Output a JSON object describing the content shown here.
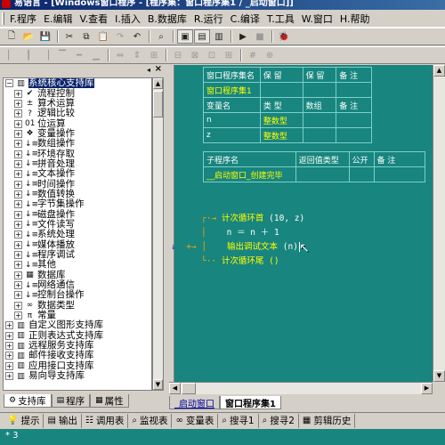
{
  "window": {
    "title": "易语言 - [Windows窗口程序 - [程序集：窗口程序集1 / _启动窗口]]"
  },
  "menu": {
    "items": [
      {
        "label": "F.程序"
      },
      {
        "label": "E.编辑"
      },
      {
        "label": "V.查看"
      },
      {
        "label": "I.插入"
      },
      {
        "label": "B.数据库"
      },
      {
        "label": "R.运行"
      },
      {
        "label": "C.编译"
      },
      {
        "label": "T.工具"
      },
      {
        "label": "W.窗口"
      },
      {
        "label": "H.帮助"
      }
    ]
  },
  "toolbar1": {
    "icons": [
      "new-file-icon",
      "open-folder-icon",
      "save-icon",
      "cut-icon",
      "copy-icon",
      "paste-icon",
      "redo-icon",
      "undo-icon",
      "find-icon",
      "layout-1-icon",
      "layout-2-icon",
      "layout-3-icon",
      "run-icon",
      "stop-icon",
      "debug-icon"
    ]
  },
  "left_panel": {
    "tree": [
      {
        "label": "系统核心支持库",
        "level": 0,
        "expander": "−",
        "icon": "library-icon",
        "selected": true
      },
      {
        "label": "流程控制",
        "level": 1,
        "expander": "+",
        "icon": "flow-control-icon"
      },
      {
        "label": "算术运算",
        "level": 1,
        "expander": "+",
        "icon": "arithmetic-icon"
      },
      {
        "label": "逻辑比较",
        "level": 1,
        "expander": "+",
        "icon": "logic-icon"
      },
      {
        "label": "位运算",
        "level": 1,
        "expander": "+",
        "icon": "bitwise-icon"
      },
      {
        "label": "变量操作",
        "level": 1,
        "expander": "+",
        "icon": "variable-icon"
      },
      {
        "label": "数组操作",
        "level": 1,
        "expander": "+",
        "icon": "array-icon"
      },
      {
        "label": "环境存取",
        "level": 1,
        "expander": "+",
        "icon": "environment-icon"
      },
      {
        "label": "拼音处理",
        "level": 1,
        "expander": "+",
        "icon": "pinyin-icon"
      },
      {
        "label": "文本操作",
        "level": 1,
        "expander": "+",
        "icon": "text-icon"
      },
      {
        "label": "时间操作",
        "level": 1,
        "expander": "+",
        "icon": "time-icon"
      },
      {
        "label": "数值转换",
        "level": 1,
        "expander": "+",
        "icon": "number-convert-icon"
      },
      {
        "label": "字节集操作",
        "level": 1,
        "expander": "+",
        "icon": "byteset-icon"
      },
      {
        "label": "磁盘操作",
        "level": 1,
        "expander": "+",
        "icon": "disk-icon"
      },
      {
        "label": "文件读写",
        "level": 1,
        "expander": "+",
        "icon": "file-rw-icon"
      },
      {
        "label": "系统处理",
        "level": 1,
        "expander": "+",
        "icon": "system-icon"
      },
      {
        "label": "媒体播放",
        "level": 1,
        "expander": "+",
        "icon": "media-icon"
      },
      {
        "label": "程序调试",
        "level": 1,
        "expander": "+",
        "icon": "debug-tree-icon"
      },
      {
        "label": "其他",
        "level": 1,
        "expander": "+",
        "icon": "other-icon"
      },
      {
        "label": "数据库",
        "level": 1,
        "expander": "+",
        "icon": "database-icon"
      },
      {
        "label": "网络通信",
        "level": 1,
        "expander": "+",
        "icon": "network-icon"
      },
      {
        "label": "控制台操作",
        "level": 1,
        "expander": "+",
        "icon": "console-icon"
      },
      {
        "label": "数据类型",
        "level": 1,
        "expander": "+",
        "icon": "datatype-icon"
      },
      {
        "label": "常量",
        "level": 1,
        "expander": "+",
        "icon": "constant-icon"
      },
      {
        "label": "自定义图形支持库",
        "level": 0,
        "expander": "+",
        "icon": "library-icon"
      },
      {
        "label": "正则表达式支持库",
        "level": 0,
        "expander": "+",
        "icon": "library-icon"
      },
      {
        "label": "远程服务支持库",
        "level": 0,
        "expander": "+",
        "icon": "library-icon"
      },
      {
        "label": "邮件接收支持库",
        "level": 0,
        "expander": "+",
        "icon": "library-icon"
      },
      {
        "label": "应用接口支持库",
        "level": 0,
        "expander": "+",
        "icon": "library-icon"
      },
      {
        "label": "易向导支持库",
        "level": 0,
        "expander": "+",
        "icon": "library-icon"
      }
    ],
    "tabs": [
      {
        "label": "支持库",
        "icon": "support-lib-tab-icon",
        "active": true
      },
      {
        "label": "程序",
        "icon": "program-tab-icon",
        "active": false
      },
      {
        "label": "属性",
        "icon": "property-tab-icon",
        "active": false
      }
    ]
  },
  "editor": {
    "class_table": {
      "headers": [
        "窗口程序集名",
        "保 留",
        "保 留",
        "备 注"
      ],
      "row": [
        "窗口程序集1",
        "",
        "",
        ""
      ]
    },
    "var_table": {
      "headers": [
        "变量名",
        "类 型",
        "数组",
        "备 注"
      ],
      "rows": [
        [
          "n",
          "整数型",
          "",
          ""
        ],
        [
          "z",
          "整数型",
          "",
          ""
        ]
      ]
    },
    "sub_table": {
      "headers": [
        "子程序名",
        "返回值类型",
        "公开",
        "备 注"
      ],
      "row": [
        "__启动窗口_创建完毕",
        "",
        "",
        ""
      ]
    },
    "code": {
      "line1_prefix": "计次循环首",
      "line1_args": "(10, z)",
      "line2": "n ＝ n ＋ 1",
      "line3_func": "输出调试文本",
      "line3_args": "(n)",
      "line4": "计次循环尾 ()"
    },
    "tabs": [
      {
        "label": "_启动窗口",
        "active": false
      },
      {
        "label": "窗口程序集1",
        "active": true
      }
    ]
  },
  "bottom_tabs": [
    {
      "label": "提示",
      "icon": "hint-icon"
    },
    {
      "label": "输出",
      "icon": "output-icon"
    },
    {
      "label": "调用表",
      "icon": "call-table-icon"
    },
    {
      "label": "监视表",
      "icon": "watch-icon"
    },
    {
      "label": "变量表",
      "icon": "var-table-icon"
    },
    {
      "label": "搜寻1",
      "icon": "search1-icon"
    },
    {
      "label": "搜寻2",
      "icon": "search2-icon"
    },
    {
      "label": "剪辑历史",
      "icon": "clip-history-icon"
    }
  ],
  "output": {
    "text": "* 3"
  },
  "colors": {
    "editor_bg": "#18857e",
    "code_keyword": "#ffff00",
    "title_bar": "#0a246a"
  }
}
